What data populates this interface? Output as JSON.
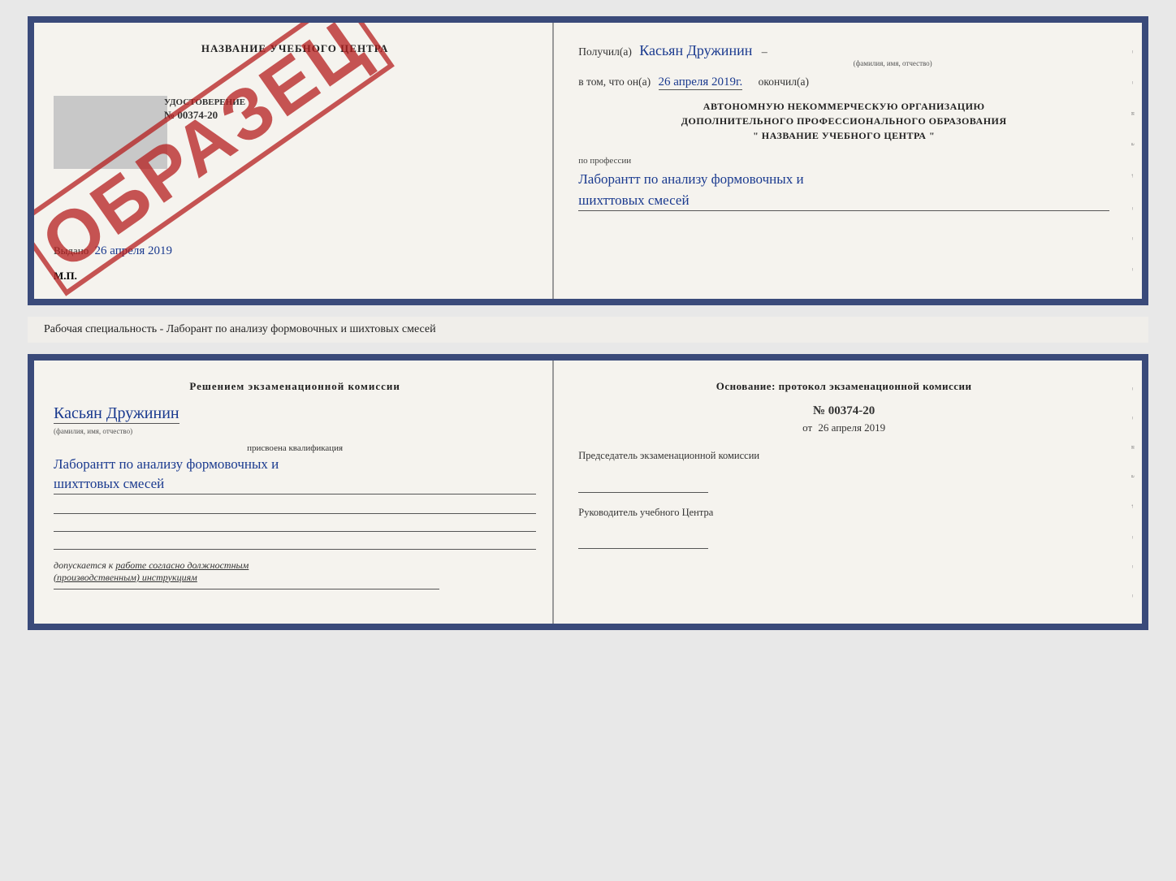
{
  "topDoc": {
    "left": {
      "certTitle": "НАЗВАНИЕ УЧЕБНОГО ЦЕНТРА",
      "udostoverenie": "УДОСТОВЕРЕНИЕ",
      "number": "№ 00374-20",
      "vydano": "Выдано",
      "vydanoDate": "26 апреля 2019",
      "mp": "М.П.",
      "obrazets": "ОБРАЗЕЦ"
    },
    "right": {
      "poluchilLabel": "Получил(а)",
      "poluchilValue": "Касьян Дружинин",
      "poluchilCaption": "(фамилия, имя, отчество)",
      "dash": "–",
      "vtomLabel": "в том, что он(а)",
      "vtomDate": "26 апреля 2019г.",
      "okonchilLabel": "окончил(а)",
      "orgLine1": "АВТОНОМНУЮ НЕКОММЕРЧЕСКУЮ ОРГАНИЗАЦИЮ",
      "orgLine2": "ДОПОЛНИТЕЛЬНОГО ПРОФЕССИОНАЛЬНОГО ОБРАЗОВАНИЯ",
      "orgLine3": "\"  НАЗВАНИЕ УЧЕБНОГО ЦЕНТРА  \"",
      "poProf": "по профессии",
      "professiya": "Лаборантт по анализу формовочных и\nшихттовых смесей"
    }
  },
  "middleLabel": "Рабочая специальность - Лаборант по анализу формовочных и шихтовых смесей",
  "bottomDoc": {
    "left": {
      "resheniemTitle": "Решением экзаменационной комиссии",
      "kasyanValue": "Касьян Дружинин",
      "fioCaption": "(фамилия, имя, отчество)",
      "prisvoenLabel": "присвоена квалификация",
      "kvalifikaciya": "Лаборантт по анализу формовочных и\nшихттовых смесей",
      "dopuskaetsyaLabel": "допускается к",
      "dopuskaetsyaValue": "работе согласно должностным\n(производственным) инструкциям"
    },
    "right": {
      "osnovanieTitleLine1": "Основание: протокол экзаменационной комиссии",
      "protocolNumber": "№ 00374-20",
      "otLabel": "от",
      "otDate": "26 апреля 2019",
      "predsedatelLabel": "Председатель экзаменационной\nкомиссии",
      "rukovoditelLabel": "Руководитель учебного\nЦентра"
    }
  },
  "sideMarks": {
    "labels": [
      "–",
      "–",
      "и",
      "а",
      "←",
      "–",
      "–",
      "–"
    ]
  }
}
